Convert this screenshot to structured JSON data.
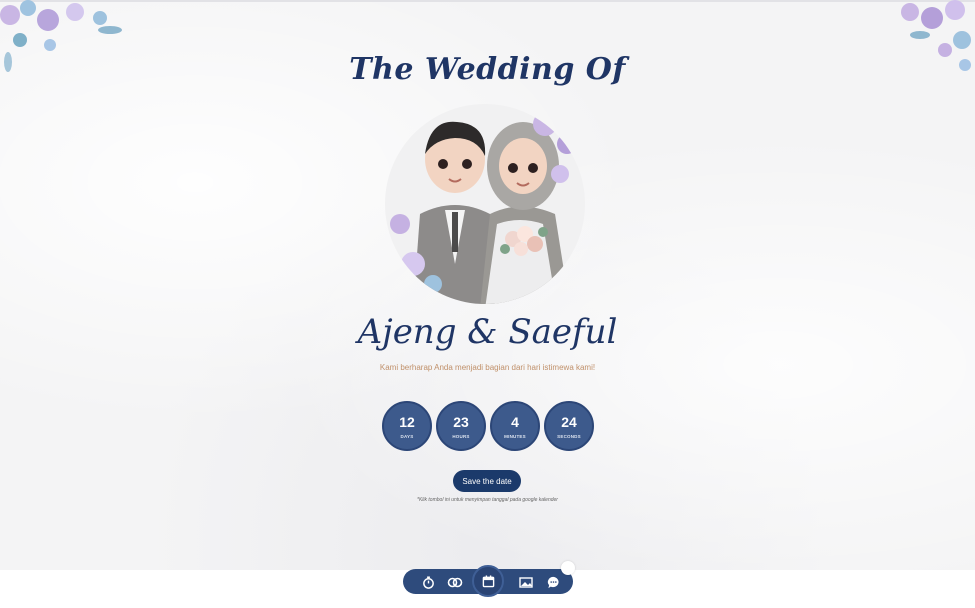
{
  "header": {
    "title": "The Wedding Of"
  },
  "couple": {
    "names": "Ajeng & Saeful",
    "tagline": "Kami berharap Anda menjadi bagian dari hari istimewa kami!"
  },
  "countdown": [
    {
      "value": "12",
      "label": "DAYS"
    },
    {
      "value": "23",
      "label": "HOURS"
    },
    {
      "value": "4",
      "label": "MINUTES"
    },
    {
      "value": "24",
      "label": "SECONDS"
    }
  ],
  "save_date": {
    "label": "Save the date",
    "note": "*Klik tombol ini untuk menyimpan tanggal pada google kalender"
  },
  "nav": {
    "items": [
      {
        "icon": "stopwatch-icon"
      },
      {
        "icon": "rings-icon"
      },
      {
        "icon": "calendar-icon",
        "active": true
      },
      {
        "icon": "gallery-icon"
      },
      {
        "icon": "chat-icon"
      }
    ]
  },
  "colors": {
    "primary": "#1f3565",
    "accent": "#c0906a",
    "countdown_bg": "#3d5a8c",
    "button_bg": "#1b3a6b"
  }
}
